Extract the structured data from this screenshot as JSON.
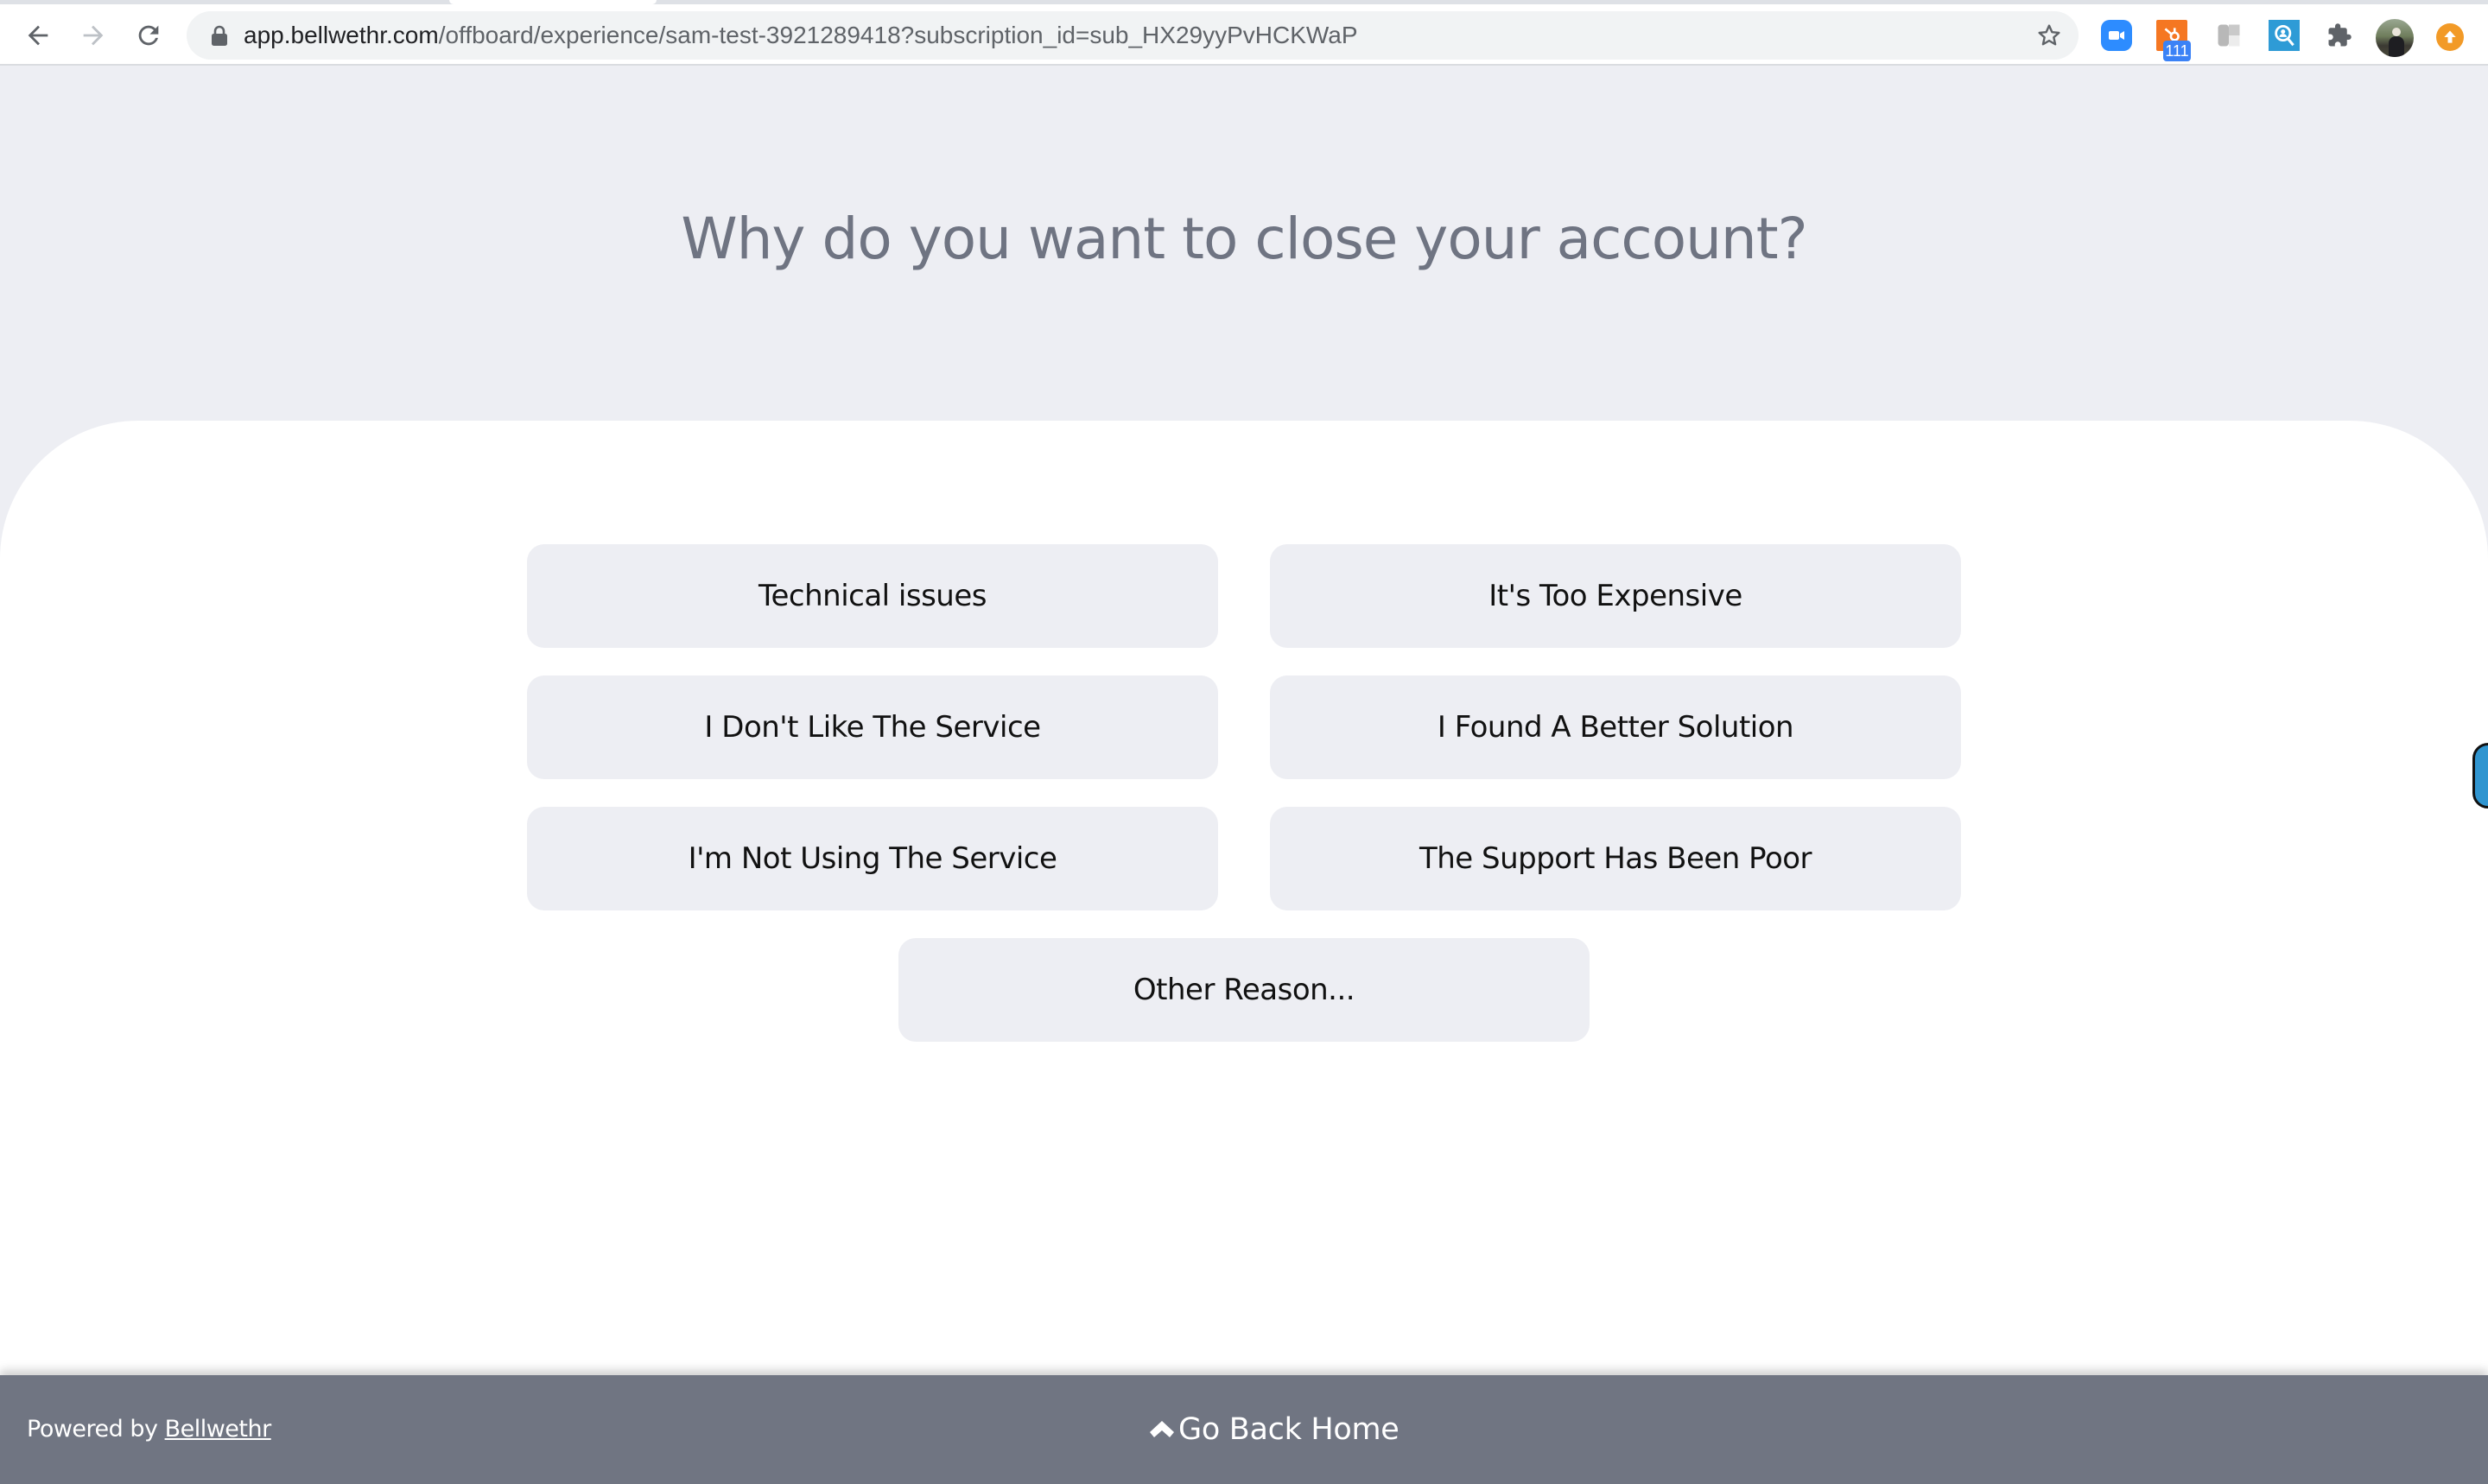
{
  "browser": {
    "url_host": "app.bellwethr.com",
    "url_path": "/offboard/experience/sam-test-3921289418?subscription_id=sub_HX29yyPvHCKWaP",
    "extensions": [
      {
        "name": "zoom-extension-icon"
      },
      {
        "name": "hubspot-extension-icon",
        "badge": "111"
      },
      {
        "name": "gray-extension-icon"
      },
      {
        "name": "search-user-extension-icon"
      },
      {
        "name": "extensions-puzzle-icon"
      }
    ],
    "icons": {
      "back": "arrow-left-icon",
      "forward": "arrow-right-icon",
      "reload": "reload-icon",
      "lock": "lock-icon",
      "bookmark": "star-icon",
      "profile": "avatar",
      "update": "update-arrow-icon"
    }
  },
  "page": {
    "question": "Why do you want to close your account?",
    "reasons": [
      {
        "label": "Technical issues"
      },
      {
        "label": "It's Too Expensive"
      },
      {
        "label": "I Don't Like The Service"
      },
      {
        "label": "I Found A Better Solution"
      },
      {
        "label": "I'm Not Using The Service"
      },
      {
        "label": "The Support Has Been Poor"
      },
      {
        "label": "Other Reason..."
      }
    ]
  },
  "footer": {
    "powered_prefix": "Powered by ",
    "powered_link": "Bellwethr",
    "go_home_label": "Go Back Home"
  },
  "colors": {
    "page_bg": "#edeef3",
    "card_bg": "#ffffff",
    "button_bg": "#edeef3",
    "question_text": "#6f7482",
    "footer_bg": "#707582",
    "side_widget": "#3095d0"
  }
}
